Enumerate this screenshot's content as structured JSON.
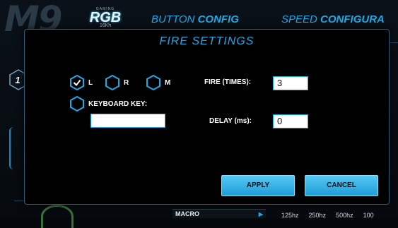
{
  "background": {
    "model_number": "M9",
    "logo": {
      "small_text": "GAMING",
      "brand": "RGB",
      "sub": "16Kh"
    },
    "tabs": [
      {
        "prefix": "BUTTON ",
        "bold": "CONFIG"
      },
      {
        "prefix": "SPEED ",
        "bold": "CONFIGURA"
      }
    ],
    "side_number": "1",
    "macro_label": "MACRO",
    "polling_rates": [
      "125hz",
      "250hz",
      "500hz",
      "100"
    ]
  },
  "dialog": {
    "title": "FIRE SETTINGS",
    "options": {
      "left": {
        "label": "L",
        "checked": true
      },
      "right": {
        "label": "R",
        "checked": false
      },
      "middle": {
        "label": "M",
        "checked": false
      },
      "keyboard": {
        "label": "KEYBOARD KEY:",
        "checked": false
      }
    },
    "keyboard_key_value": "",
    "fire_times_label": "FIRE (TIMES):",
    "fire_times_value": "3",
    "delay_label": "DELAY (ms):",
    "delay_value": "0",
    "apply_label": "APPLY",
    "cancel_label": "CANCEL"
  },
  "colors": {
    "accent": "#1fa8e6",
    "button": "#3bb8ee",
    "background": "#000000"
  },
  "icons": [
    "hexagon-check-icon",
    "hexagon-icon",
    "chevron-right-icon"
  ]
}
